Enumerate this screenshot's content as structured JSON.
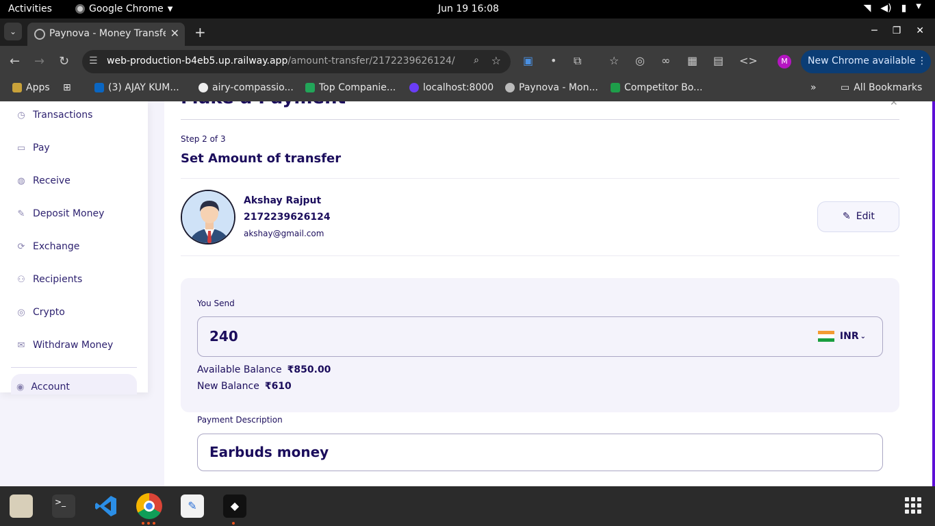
{
  "topbar": {
    "activities": "Activities",
    "app": "Google Chrome",
    "clock": "Jun 19  16:08"
  },
  "browser": {
    "tab_title": "Paynova - Money Transfe",
    "url_host": "web-production-b4eb5.up.railway.app",
    "url_path": "/amount-transfer/2172239626124/",
    "profile_initial": "M",
    "update_label": "New Chrome available"
  },
  "bookmarks": [
    {
      "label": "Apps",
      "icon": "apps-grid-icon",
      "color": "#dddddd"
    },
    {
      "label": "(3) AJAY KUM...",
      "icon": "linkedin-icon",
      "color": "#0a66c2"
    },
    {
      "label": "airy-compassio...",
      "icon": "github-icon",
      "color": "#111111"
    },
    {
      "label": "Top Companie...",
      "icon": "sheet-icon",
      "color": "#22a559"
    },
    {
      "label": "localhost:8000",
      "icon": "moon-icon",
      "color": "#6a3df5"
    },
    {
      "label": "Paynova - Mon...",
      "icon": "globe-icon",
      "color": "#bbbbbb"
    },
    {
      "label": "Competitor Bo...",
      "icon": "sheets-icon",
      "color": "#1e9e4a"
    }
  ],
  "all_bookmarks": "All Bookmarks",
  "sidebar": {
    "items": [
      {
        "label": "Transactions",
        "icon": "history-icon"
      },
      {
        "label": "Pay",
        "icon": "pay-icon"
      },
      {
        "label": "Receive",
        "icon": "receive-icon"
      },
      {
        "label": "Deposit Money",
        "icon": "deposit-icon"
      },
      {
        "label": "Exchange",
        "icon": "exchange-icon"
      },
      {
        "label": "Recipients",
        "icon": "user-icon"
      },
      {
        "label": "Crypto",
        "icon": "crypto-icon"
      },
      {
        "label": "Withdraw Money",
        "icon": "withdraw-icon"
      }
    ],
    "account": "Account"
  },
  "main": {
    "heading": "Make a Payment",
    "step": "Step 2 of 3",
    "subtitle": "Set Amount of transfer",
    "recipient": {
      "name": "Akshay Rajput",
      "account": "2172239626124",
      "email": "akshay@gmail.com"
    },
    "edit_label": "Edit",
    "you_send_label": "You Send",
    "amount": "240",
    "currency": "INR",
    "available_label": "Available Balance",
    "available_value": "₹850.00",
    "new_balance_label": "New Balance",
    "new_balance_value": "₹610",
    "desc_label": "Payment Description",
    "desc_value": "Earbuds money"
  },
  "colors": {
    "accent": "#1b0d5c",
    "brand_edge": "#5d0fd6"
  }
}
